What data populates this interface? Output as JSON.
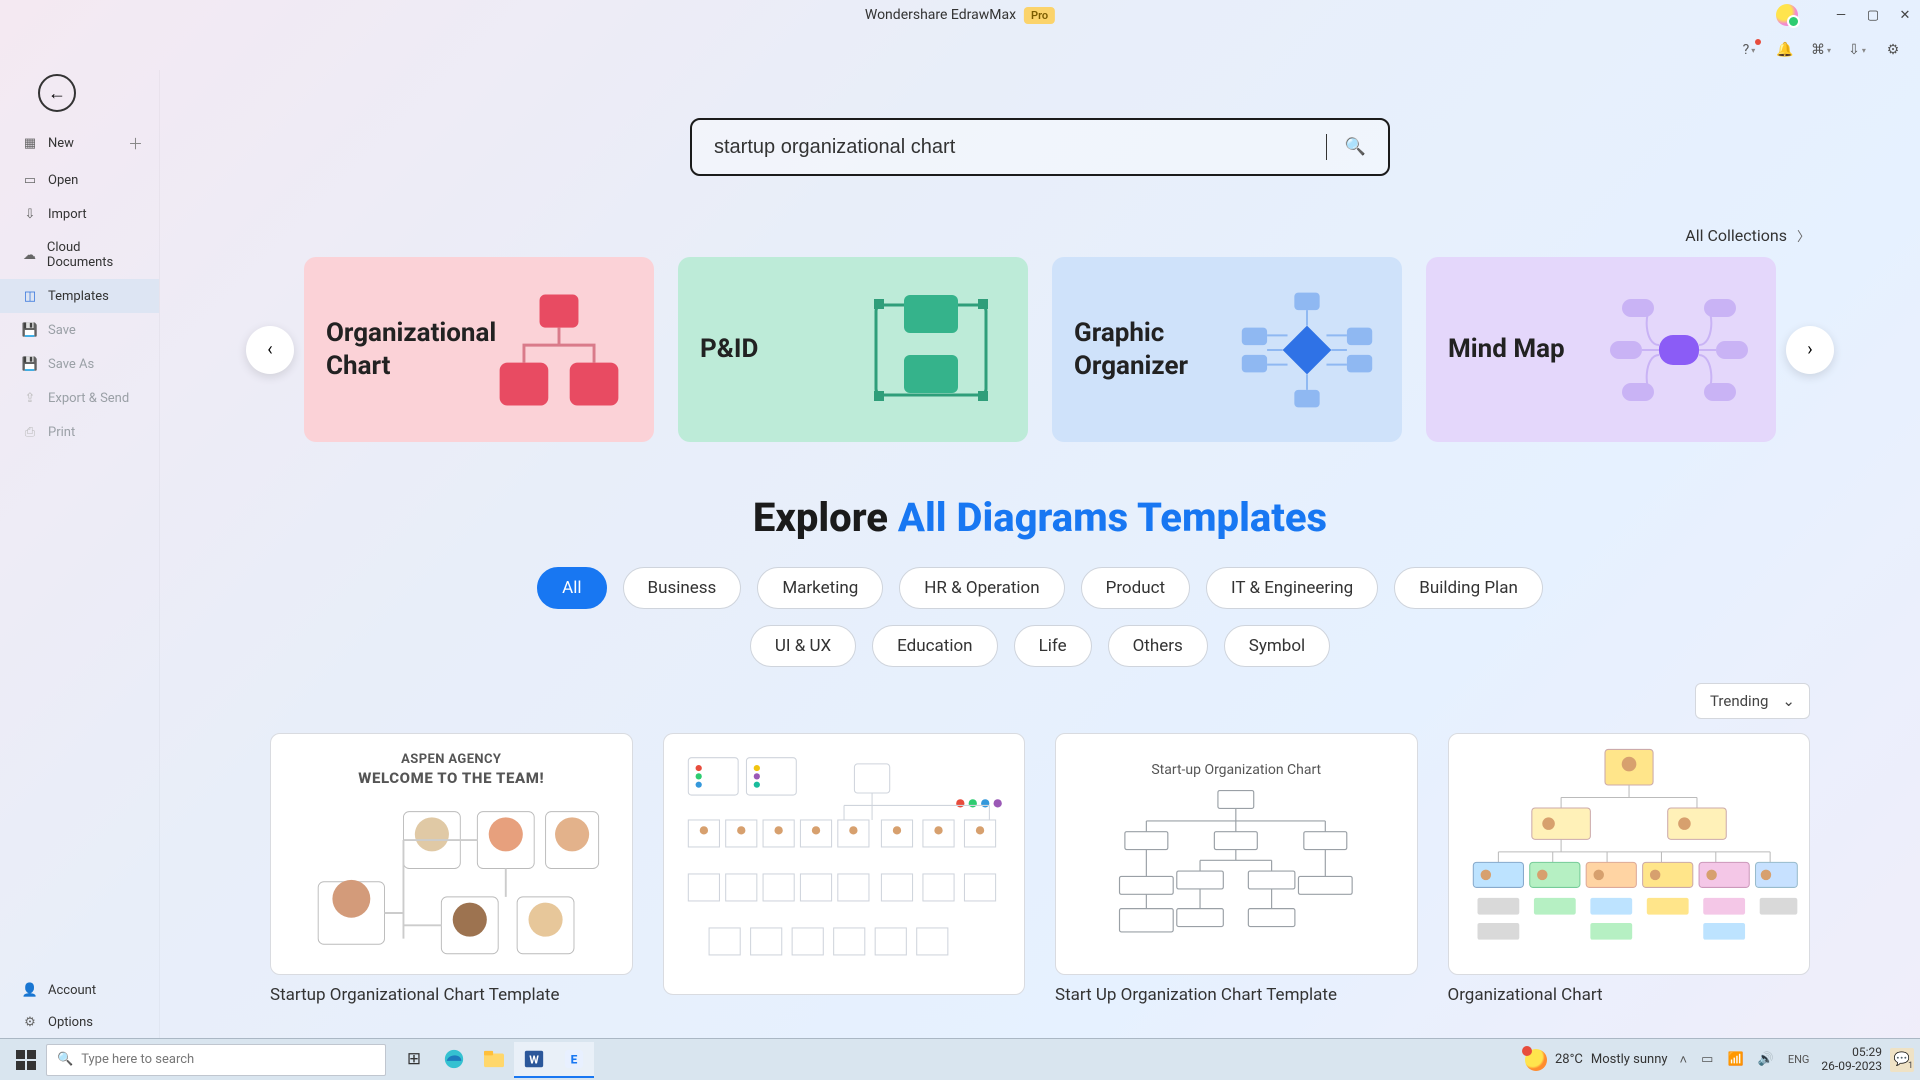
{
  "titlebar": {
    "appname": "Wondershare EdrawMax",
    "badge": "Pro"
  },
  "sidebar": {
    "items": [
      {
        "label": "New",
        "icon": "plus-square-icon",
        "hasPlus": true
      },
      {
        "label": "Open",
        "icon": "folder-icon"
      },
      {
        "label": "Import",
        "icon": "import-icon"
      },
      {
        "label": "Cloud Documents",
        "icon": "cloud-icon"
      },
      {
        "label": "Templates",
        "icon": "templates-icon",
        "active": true
      },
      {
        "label": "Save",
        "icon": "save-icon",
        "dim": true
      },
      {
        "label": "Save As",
        "icon": "saveas-icon",
        "dim": true
      },
      {
        "label": "Export & Send",
        "icon": "export-icon",
        "dim": true
      },
      {
        "label": "Print",
        "icon": "print-icon",
        "dim": true
      }
    ],
    "bottom": [
      {
        "label": "Account",
        "icon": "account-icon"
      },
      {
        "label": "Options",
        "icon": "gear-icon"
      }
    ]
  },
  "search": {
    "value": "startup organizational chart"
  },
  "allCollections": "All Collections",
  "categories": [
    {
      "label": "Organizational Chart"
    },
    {
      "label": "P&ID"
    },
    {
      "label": "Graphic Organizer"
    },
    {
      "label": "Mind Map"
    }
  ],
  "explore": {
    "lead": "Explore ",
    "accent": "All Diagrams Templates"
  },
  "chips": [
    "All",
    "Business",
    "Marketing",
    "HR & Operation",
    "Product",
    "IT & Engineering",
    "Building Plan",
    "UI & UX",
    "Education",
    "Life",
    "Others",
    "Symbol"
  ],
  "chipActive": "All",
  "sort": {
    "label": "Trending"
  },
  "templates": [
    {
      "caption": "Startup Organizational Chart Template"
    },
    {
      "caption": ""
    },
    {
      "caption": "Start Up Organization Chart Template"
    },
    {
      "caption": "Organizational Chart"
    }
  ],
  "thumb1": {
    "agency": "ASPEN AGENCY",
    "welcome": "WELCOME TO THE TEAM!"
  },
  "thumb3": {
    "heading": "Start-up Organization Chart"
  },
  "taskbar": {
    "searchPlaceholder": "Type here to search",
    "weatherTemp": "28°C",
    "weatherText": "Mostly sunny",
    "time": "05:29",
    "date": "26-09-2023",
    "notifCount": "1"
  }
}
